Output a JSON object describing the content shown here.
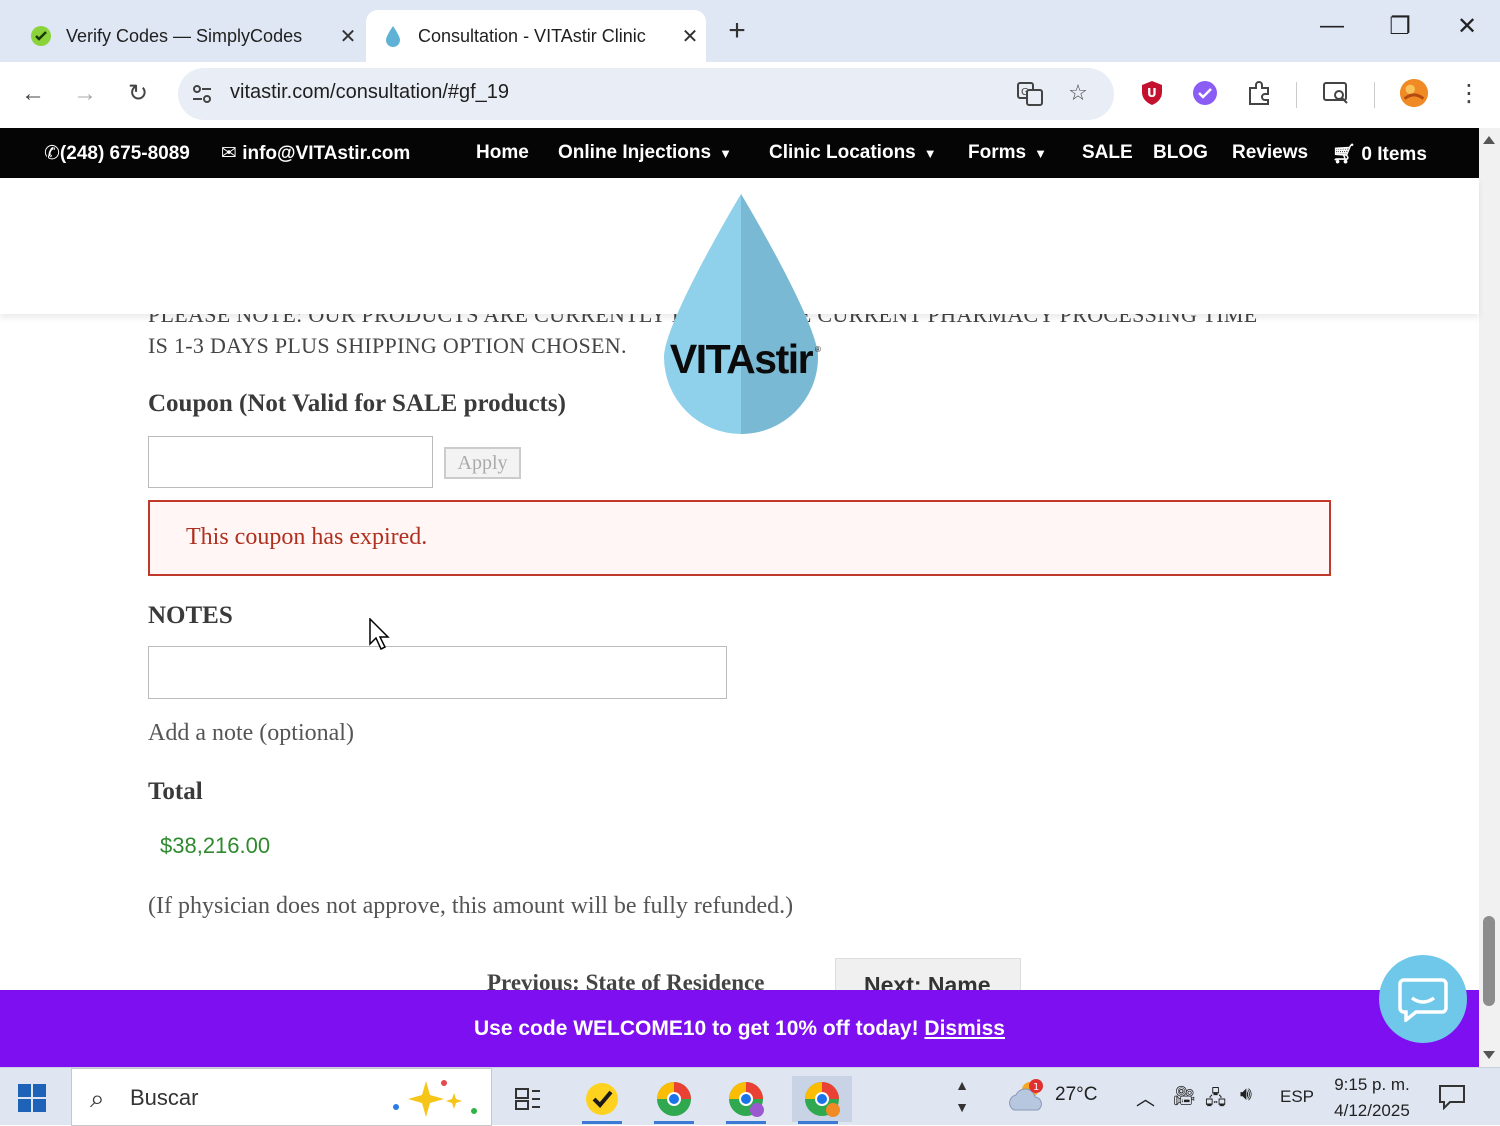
{
  "browser": {
    "tabs": [
      {
        "title": "Verify Codes — SimplyCodes",
        "active": false
      },
      {
        "title": "Consultation - VITAstir Clinic",
        "active": true
      }
    ],
    "url": "vitastir.com/consultation/#gf_19"
  },
  "site": {
    "phone": "(248) 675-8089",
    "email": "info@VITAstir.com",
    "nav": {
      "home": "Home",
      "online_injections": "Online Injections",
      "clinic_locations": "Clinic Locations",
      "forms": "Forms",
      "sale": "SALE",
      "blog": "BLOG",
      "reviews": "Reviews",
      "cart": "0 Items"
    },
    "logo_text": "VITAstir"
  },
  "form": {
    "notice_line1": "PLEASE NOTE: OUR PRODUCTS ARE CURRENTLY IN ... ND. THE CURRENT PHARMACY PROCESSING TIME",
    "notice_line2": "IS 1-3 DAYS PLUS SHIPPING OPTION CHOSEN.",
    "coupon_label": "Coupon (Not Valid for SALE products)",
    "coupon_value": "",
    "apply_label": "Apply",
    "error_message": "This coupon has expired.",
    "notes_label": "NOTES",
    "notes_value": "",
    "notes_hint": "Add a note (optional)",
    "total_label": "Total",
    "total_value": "$38,216.00",
    "refund_note": "(If physician does not approve, this amount will be fully refunded.)",
    "previous_label": "Previous: State of Residence",
    "next_label": "Next: Name"
  },
  "promo": {
    "text": "Use code WELCOME10 to get 10% off today!",
    "dismiss": "Dismiss"
  },
  "taskbar": {
    "search_placeholder": "Buscar",
    "weather": "27°C",
    "weather_badge": "1",
    "language": "ESP",
    "time": "9:15 p. m.",
    "date": "4/12/2025"
  },
  "colors": {
    "promo_bg": "#7d0ff0",
    "error_border": "#c0392b",
    "total_green": "#2f8a2f",
    "topbar_bg": "#050505",
    "logo_blue": "#7fc4e0"
  }
}
